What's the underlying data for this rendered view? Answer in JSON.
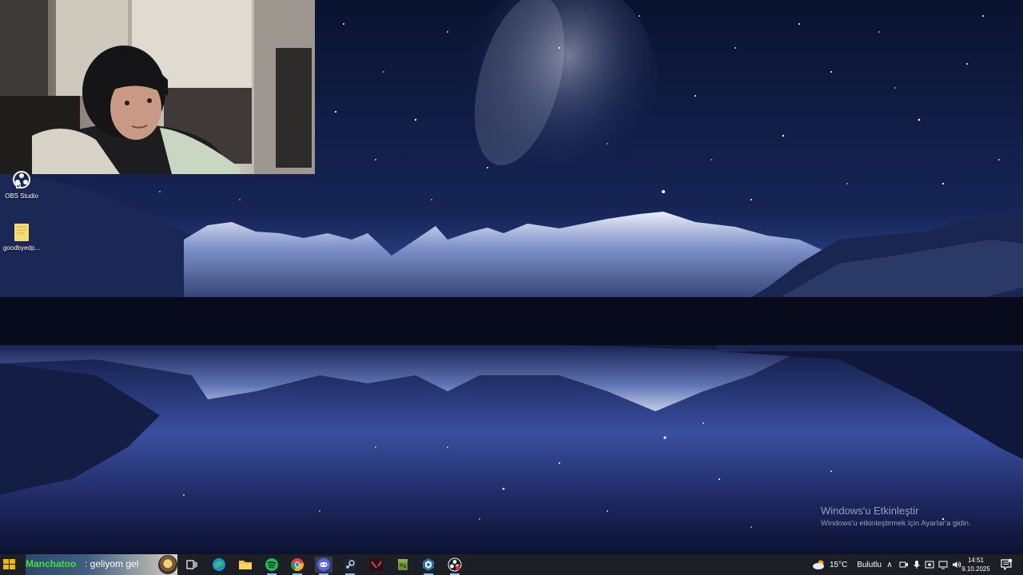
{
  "desktop": {
    "icons": [
      {
        "label": "OBS Studio",
        "icon": "obs-studio-icon"
      },
      {
        "label": "goodbyedp...",
        "icon": "folder-icon"
      }
    ],
    "activation": {
      "title": "Windows'u Etkinleştir",
      "subtitle": "Windows'u etkinleştirmek için Ayarlar'a gidin."
    }
  },
  "stream_overlay": {
    "chat_username": "Manchatoo",
    "chat_message": ": geliyom gel",
    "webcam": "webcam-feed"
  },
  "taskbar": {
    "pinned": [
      {
        "name": "task-view",
        "icon": "task-view-icon"
      },
      {
        "name": "edge",
        "icon": "edge-icon"
      },
      {
        "name": "file-explorer",
        "icon": "folder-icon"
      },
      {
        "name": "spotify",
        "icon": "spotify-icon"
      },
      {
        "name": "chrome",
        "icon": "chrome-icon"
      },
      {
        "name": "discord",
        "icon": "discord-icon"
      },
      {
        "name": "steam",
        "icon": "steam-icon"
      },
      {
        "name": "valorant",
        "icon": "valorant-icon"
      },
      {
        "name": "minecraft",
        "icon": "minecraft-icon"
      },
      {
        "name": "app",
        "icon": "app-icon"
      },
      {
        "name": "obs",
        "icon": "obs-icon"
      }
    ],
    "weather": {
      "temperature": "15°C",
      "condition": "Bulutlu"
    },
    "clock": {
      "time": "14:51",
      "date": "9.10.2025"
    }
  },
  "colors": {
    "taskbar_bg": "#1d1f27",
    "chat_username": "#3fe03a"
  }
}
